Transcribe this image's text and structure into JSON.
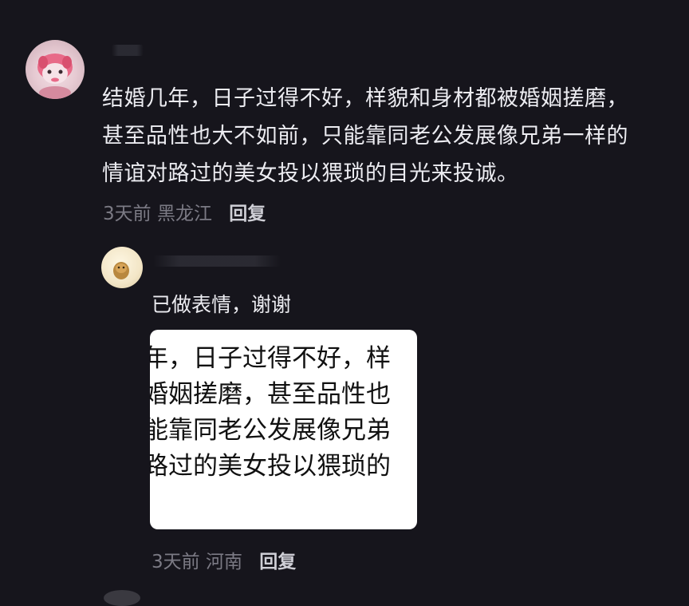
{
  "comment": {
    "text_lines": [
      "结婚几年，日子过得不好，样貌和身材都被婚姻搓磨，",
      "甚至品性也大不如前，只能靠同老公发展像兄弟一样的",
      "情谊对路过的美女投以猥琐的目光来投诚。"
    ],
    "meta": "3天前 黑龙江",
    "reply_label": "回复"
  },
  "reply": {
    "text": "已做表情，谢谢",
    "sticker_lines": [
      "年，日子过得不好，样",
      "婚姻搓磨，甚至品性也",
      "能靠同老公发展像兄弟",
      "路过的美女投以猥琐的"
    ],
    "meta": "3天前 河南",
    "reply_label": "回复"
  }
}
